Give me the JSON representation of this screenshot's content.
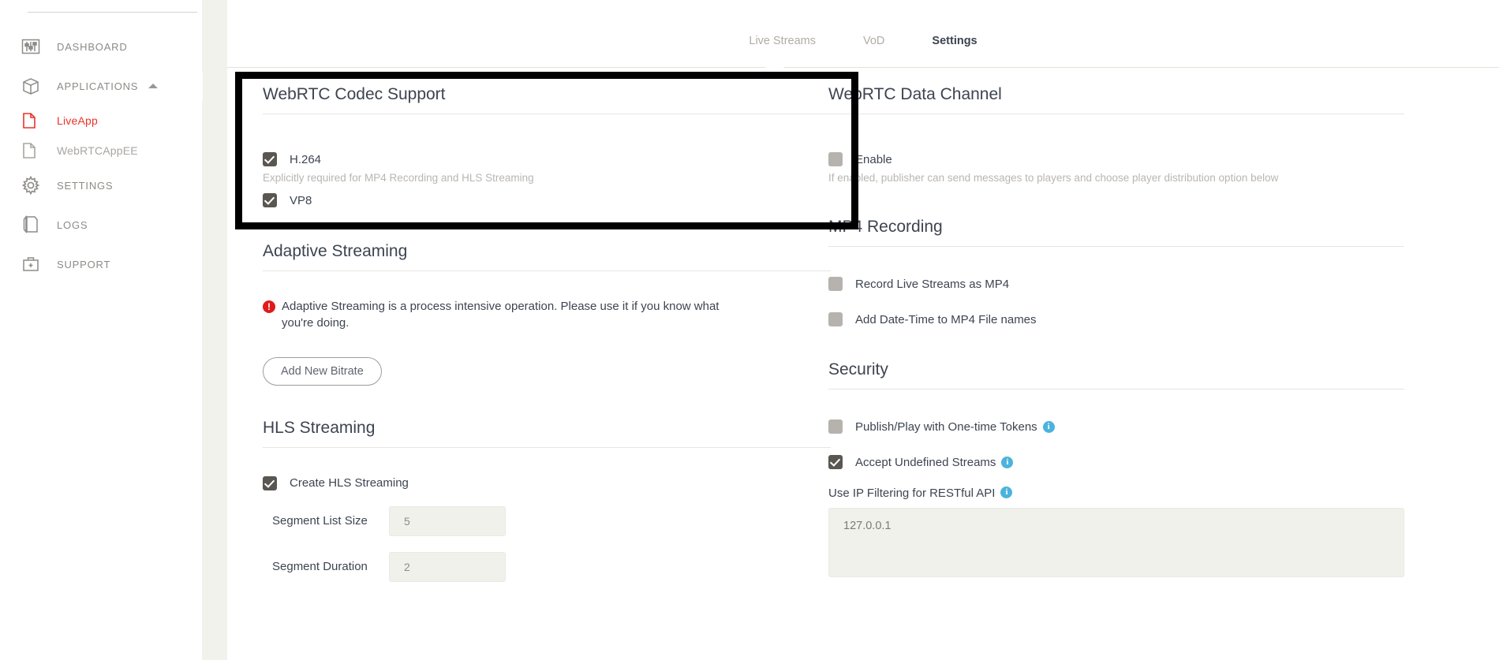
{
  "sidebar": {
    "items": [
      {
        "label": "DASHBOARD",
        "icon": "sliders-icon",
        "name": "dashboard"
      },
      {
        "label": "APPLICATIONS",
        "icon": "box-icon",
        "name": "applications",
        "expandable": true
      },
      {
        "label": "SETTINGS",
        "icon": "gear-icon",
        "name": "settings"
      },
      {
        "label": "LOGS",
        "icon": "logs-icon",
        "name": "logs"
      },
      {
        "label": "SUPPORT",
        "icon": "support-icon",
        "name": "support"
      }
    ],
    "sub_items": [
      {
        "label": "LiveApp",
        "icon": "file-icon",
        "name": "liveapp",
        "active": true
      },
      {
        "label": "WebRTCAppEE",
        "icon": "file-icon",
        "name": "webrtcappee",
        "active": false
      }
    ]
  },
  "tabs": [
    {
      "label": "Live Streams",
      "active": false
    },
    {
      "label": "VoD",
      "active": false
    },
    {
      "label": "Settings",
      "active": true
    }
  ],
  "left_column": {
    "codec": {
      "title": "WebRTC Codec Support",
      "items": [
        {
          "label": "H.264",
          "checked": true,
          "help": "Explicitly required for MP4 Recording and HLS Streaming"
        },
        {
          "label": "VP8",
          "checked": true,
          "help": ""
        }
      ]
    },
    "adaptive": {
      "title": "Adaptive Streaming",
      "warning": "Adaptive Streaming is a process intensive operation. Please use it if you know what you're doing.",
      "button_label": "Add New Bitrate"
    },
    "hls": {
      "title": "HLS Streaming",
      "checkbox_label": "Create HLS Streaming",
      "checkbox_checked": true,
      "fields": [
        {
          "label": "Segment List Size",
          "value": "5"
        },
        {
          "label": "Segment Duration",
          "value": "2"
        }
      ]
    }
  },
  "right_column": {
    "data_channel": {
      "title": "WebRTC Data Channel",
      "checkbox_label": "Enable",
      "checkbox_checked": false,
      "help": "If enabled, publisher can send messages to players and choose player distribution option below"
    },
    "mp4": {
      "title": "MP4 Recording",
      "items": [
        {
          "label": "Record Live Streams as MP4",
          "checked": false
        },
        {
          "label": "Add Date-Time to MP4 File names",
          "checked": false
        }
      ]
    },
    "security": {
      "title": "Security",
      "items": [
        {
          "label": "Publish/Play with One-time Tokens",
          "checked": false,
          "info": true
        },
        {
          "label": "Accept Undefined Streams",
          "checked": true,
          "info": true
        }
      ],
      "ip_filter_label": "Use IP Filtering for RESTful API",
      "ip_filter_value": "127.0.0.1"
    }
  },
  "colors": {
    "accent_red": "#e8332a",
    "info_blue": "#4bb3dc",
    "warning_red": "#e01b1b",
    "checkbox_on": "#5a5651",
    "checkbox_off": "#b6b3ae",
    "text_dark": "#3d4450",
    "text_muted": "#8d8b87",
    "panel_bg": "#f2f2ed",
    "highlight_border": "#000000"
  },
  "highlight": {
    "target": "webrtc-codec-support-section"
  }
}
